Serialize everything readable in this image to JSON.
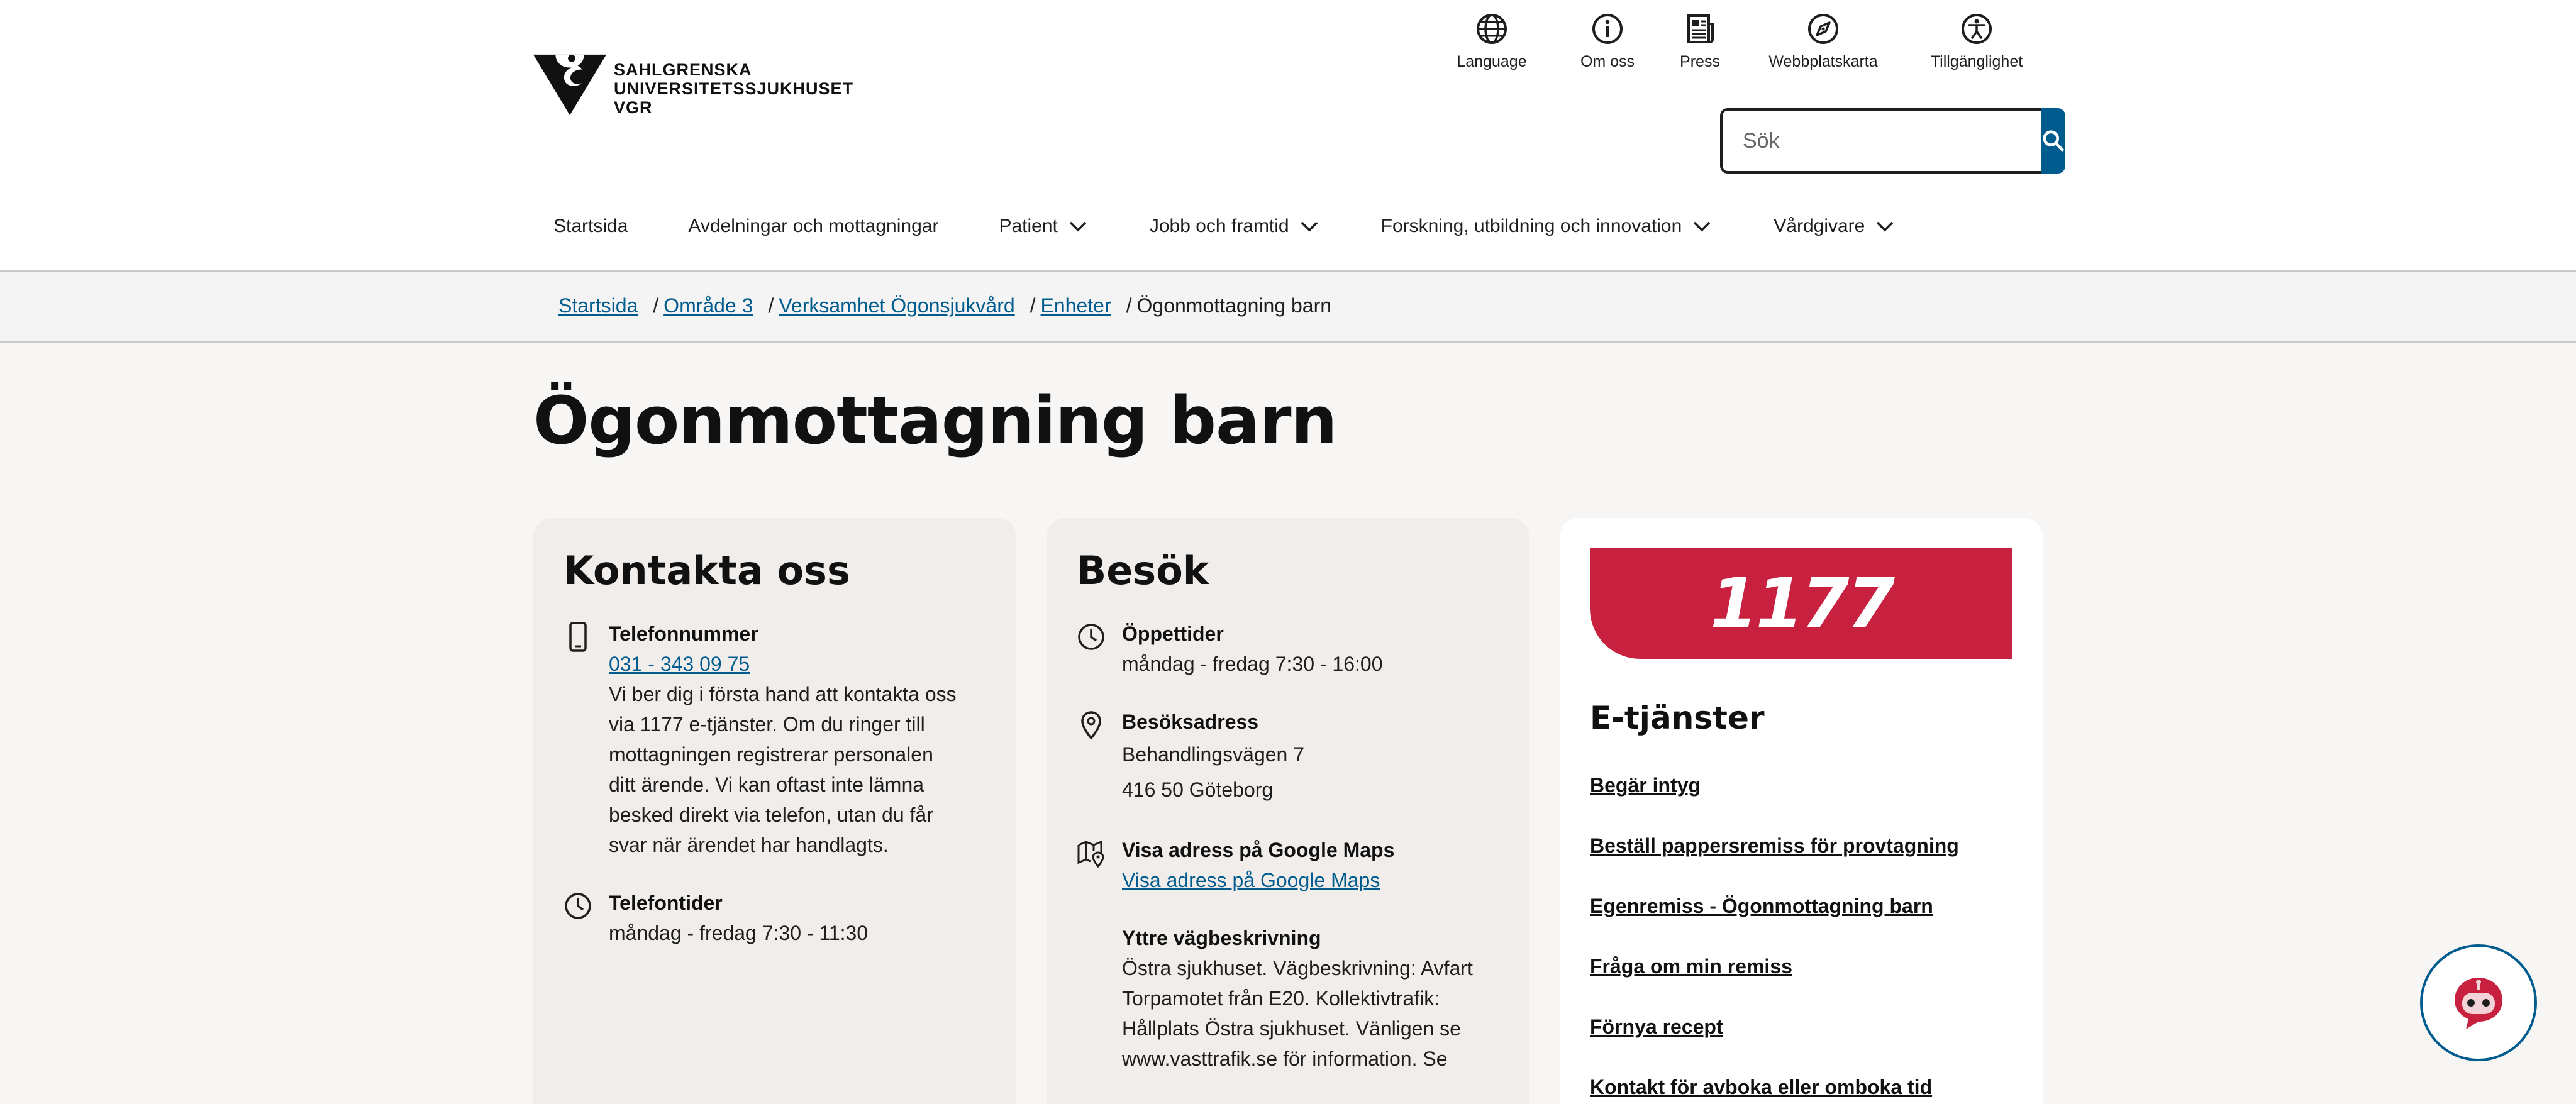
{
  "logo": {
    "line1": "SAHLGRENSKA",
    "line2": "UNIVERSITETSSJUKHUSET",
    "line3": "VGR"
  },
  "utility_nav": [
    {
      "label": "Language",
      "icon": "globe-icon"
    },
    {
      "label": "Om oss",
      "icon": "info-icon"
    },
    {
      "label": "Press",
      "icon": "newspaper-icon"
    },
    {
      "label": "Webbplatskarta",
      "icon": "compass-icon"
    },
    {
      "label": "Tillgänglighet",
      "icon": "accessibility-icon"
    }
  ],
  "search": {
    "placeholder": "Sök",
    "value": "",
    "button_icon": "search-icon"
  },
  "main_nav": [
    {
      "label": "Startsida",
      "has_dropdown": false
    },
    {
      "label": "Avdelningar och mottagningar",
      "has_dropdown": false
    },
    {
      "label": "Patient",
      "has_dropdown": true
    },
    {
      "label": "Jobb och framtid",
      "has_dropdown": true
    },
    {
      "label": "Forskning, utbildning och innovation",
      "has_dropdown": true
    },
    {
      "label": "Vårdgivare",
      "has_dropdown": true
    }
  ],
  "breadcrumb": {
    "items": [
      "Startsida",
      "Område 3",
      "Verksamhet Ögonsjukvård",
      "Enheter"
    ],
    "separator": "/",
    "current": "Ögonmottagning barn"
  },
  "page_title": "Ögonmottagning barn",
  "contact": {
    "title": "Kontakta oss",
    "phone": {
      "label": "Telefonnummer",
      "number": "031 - 343 09 75",
      "text_lines": [
        "Vi ber dig i första hand att kontakta oss",
        "via 1177 e-tjänster. Om du ringer till",
        "mottagningen registrerar personalen",
        "ditt ärende. Vi kan oftast inte lämna",
        "besked direkt via telefon, utan du får",
        "svar när ärendet har handlagts."
      ]
    },
    "phone_hours": {
      "label": "Telefontider",
      "value": "måndag - fredag 7:30 - 11:30"
    }
  },
  "visit": {
    "title": "Besök",
    "opening_hours": {
      "label": "Öppettider",
      "value": "måndag - fredag 7:30 - 16:00"
    },
    "address": {
      "label": "Besöksadress",
      "line1": "Behandlingsvägen 7",
      "line2": "416 50 Göteborg"
    },
    "maps": {
      "label": "Visa adress på Google Maps",
      "link": "Visa adress på Google Maps"
    },
    "directions": {
      "label": "Yttre vägbeskrivning",
      "lines": [
        "Östra sjukhuset. Vägbeskrivning: Avfart",
        "Torpamotet från E20. Kollektivtrafik:",
        "Hållplats Östra sjukhuset. Vänligen se",
        "www.vasttrafik.se för information. Se"
      ]
    }
  },
  "eservices": {
    "brand": "1177",
    "title": "E-tjänster",
    "links": [
      "Begär intyg",
      "Beställ pappersremiss för provtagning",
      "Egenremiss - Ögonmottagning barn",
      "Fråga om min remiss",
      "Förnya recept",
      "Kontakt för avboka eller omboka tid"
    ]
  },
  "colors": {
    "link": "#005b8e",
    "brand_1177": "#c8213f",
    "search_button": "#005b8e",
    "card_bg": "#f0edea"
  }
}
